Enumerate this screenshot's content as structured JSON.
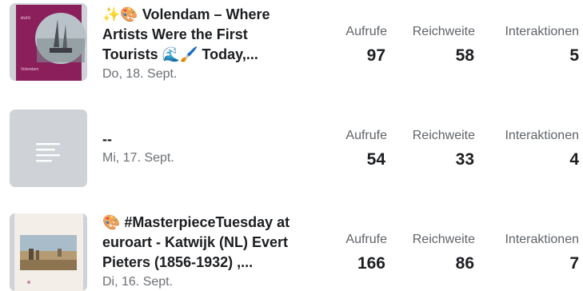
{
  "posts": [
    {
      "title_lines": [
        "✨🎨 Volendam – Where",
        "Artists Were the First",
        "Tourists 🌊🖌️ Today,..."
      ],
      "date": "Do, 18. Sept.",
      "thumbnail": {
        "type": "cover",
        "bg": "#8a1f5c",
        "caption": "Volendam"
      },
      "metrics": [
        {
          "label": "Aufrufe",
          "value": "97"
        },
        {
          "label": "Reichweite",
          "value": "58"
        },
        {
          "label": "Interaktionen",
          "value": "5"
        }
      ]
    },
    {
      "title_lines": [
        "--"
      ],
      "date": "Mi, 17. Sept.",
      "thumbnail": {
        "type": "placeholder",
        "icon": "text-lines-icon",
        "bg": "#cfd2d6"
      },
      "metrics": [
        {
          "label": "Aufrufe",
          "value": "54"
        },
        {
          "label": "Reichweite",
          "value": "33"
        },
        {
          "label": "Interaktionen",
          "value": "4"
        }
      ]
    },
    {
      "title_lines": [
        "🎨 #MasterpieceTuesday at",
        "euroart - Katwijk (NL) Evert",
        "Pieters (1856-1932) ,..."
      ],
      "date": "Di, 16. Sept.",
      "thumbnail": {
        "type": "painting",
        "bg": "#f3eee8"
      },
      "metrics": [
        {
          "label": "Aufrufe",
          "value": "166"
        },
        {
          "label": "Reichweite",
          "value": "86"
        },
        {
          "label": "Interaktionen",
          "value": "7"
        }
      ]
    }
  ]
}
